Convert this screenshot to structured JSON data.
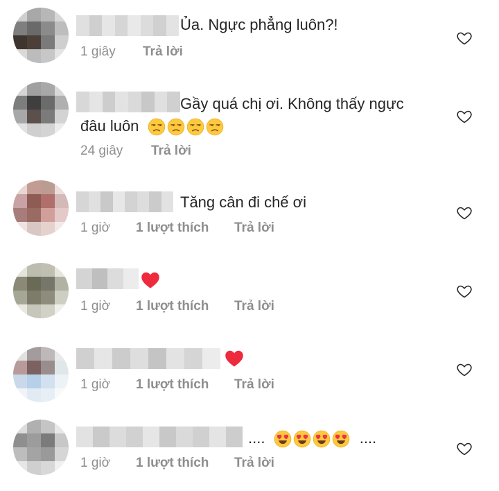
{
  "colors": {
    "text": "#262626",
    "meta": "#8e8e8e",
    "heart_red": "#ed2b3d",
    "emoji_yellow": "#ffc83d"
  },
  "comments": [
    {
      "text": "Ủa. Ngực phẳng luôn?!",
      "time": "1 giây",
      "reply": "Trả lời",
      "avatar": [
        "#cfcfcf",
        "#a8a8a8",
        "#b7b7b7",
        "#d8d8d8",
        "#7f7f7f",
        "#6a6a6a",
        "#8b8b8b",
        "#bdbdbd",
        "#3e352f",
        "#4b3f37",
        "#7a7a7a",
        "#cfcfcf",
        "#d9d9d9",
        "#bcbcbc",
        "#c7c7c7",
        "#e4e4e4"
      ],
      "username_blocks": [
        "#e0e0e0",
        "#cfcfcf",
        "#e6e6e6",
        "#d6d6d6",
        "#e9e9e9",
        "#dcdcdc",
        "#d0d0d0",
        "#e3e3e3"
      ]
    },
    {
      "text": "Gầy quá chị ơi. Không thấy ngực",
      "text_line2": "đâu luôn",
      "emoji": [
        "unamused-face-emoji",
        "unamused-face-emoji",
        "unamused-face-emoji",
        "unamused-face-emoji"
      ],
      "time": "24 giây",
      "reply": "Trả lời",
      "avatar": [
        "#d5d5d5",
        "#a0a0a0",
        "#a8a8a8",
        "#d9d9d9",
        "#7d7d7d",
        "#3f3f3f",
        "#6b6b6b",
        "#b0b0b0",
        "#a8a8a8",
        "#5b504c",
        "#7b7b7b",
        "#d3d3d3",
        "#e2e2e2",
        "#cfcfcf",
        "#d4d4d4",
        "#ececec"
      ],
      "username_blocks": [
        "#d8d8d8",
        "#e5e5e5",
        "#cdcdcd",
        "#e3e3e3",
        "#dadada",
        "#c8c8c8",
        "#e0e0e0",
        "#d0d0d0"
      ]
    },
    {
      "text": "Tăng cân đi chế ơi",
      "time": "1 giờ",
      "likes": "1 lượt thích",
      "reply": "Trả lời",
      "avatar": [
        "#e8d6d3",
        "#c49b92",
        "#bb9c93",
        "#ecdedd",
        "#c8a2a4",
        "#8e5c55",
        "#b06f6a",
        "#d4b9b9",
        "#a77d79",
        "#9a6b63",
        "#d19f99",
        "#e3c9c8",
        "#efe3e2",
        "#d9c7c3",
        "#e6d1cd",
        "#f2eaea"
      ],
      "username_blocks": [
        "#d6d6d6",
        "#e0e0e0",
        "#c9c9c9",
        "#e7e7e7",
        "#d3d3d3",
        "#dddddd",
        "#cbcbcb",
        "#e2e2e2"
      ]
    },
    {
      "text": "",
      "emoji_after_name": "red-heart-emoji",
      "time": "1 giờ",
      "likes": "1 lượt thích",
      "reply": "Trả lời",
      "avatar": [
        "#e4e4dc",
        "#bcbcaf",
        "#c0bfb2",
        "#e6e6df",
        "#8a8a77",
        "#6b6a57",
        "#76766a",
        "#b2b2a4",
        "#a7a797",
        "#7d7c6a",
        "#8d8c7d",
        "#cfcec3",
        "#e8e8e1",
        "#c6c6bb",
        "#d2d1c6",
        "#f0f0eb"
      ],
      "username_blocks": [
        "#d4d4d4",
        "#bfbfbf",
        "#dcdcdc",
        "#ececec"
      ]
    },
    {
      "text": "",
      "emoji_after_name": "red-heart-emoji",
      "time": "1 giờ",
      "likes": "1 lượt thích",
      "reply": "Trả lời",
      "avatar": [
        "#e0e0e0",
        "#a49c9c",
        "#bfb8b8",
        "#e9e9e9",
        "#b89a9a",
        "#7b6161",
        "#9a8d8d",
        "#e0e7e9",
        "#c9d9ea",
        "#b6d0ea",
        "#d2e0ef",
        "#edf2f6",
        "#f0f4f8",
        "#e2eaf3",
        "#e7eef5",
        "#f7f9fb"
      ],
      "username_blocks": [
        "#d0d0d0",
        "#e6e6e6",
        "#cccccc",
        "#dedede",
        "#c4c4c4",
        "#e3e3e3",
        "#d5d5d5",
        "#ececec"
      ]
    },
    {
      "text": "....",
      "emoji": [
        "heart-eyes-emoji",
        "heart-eyes-emoji",
        "heart-eyes-emoji",
        "heart-eyes-emoji"
      ],
      "text_after": "....",
      "time": "1 giờ",
      "likes": "1 lượt thích",
      "reply": "Trả lời",
      "avatar": [
        "#dcdcdc",
        "#b0b0b0",
        "#c5c5c5",
        "#e8e8e8",
        "#8f8f8f",
        "#9c9c9c",
        "#7b7b7b",
        "#c8c8c8",
        "#bdbdbd",
        "#a4a4a4",
        "#9a9a9a",
        "#d6d6d6",
        "#e6e6e6",
        "#cfcfcf",
        "#d8d8d8",
        "#f0f0f0"
      ],
      "username_blocks": [
        "#e2e2e2",
        "#cacaca",
        "#dcdcdc",
        "#d1d1d1",
        "#e6e6e6",
        "#c8c8c8",
        "#dadada",
        "#d0d0d0",
        "#e4e4e4",
        "#cdcdcd"
      ]
    }
  ],
  "icons": {
    "like": "heart-outline-icon"
  }
}
